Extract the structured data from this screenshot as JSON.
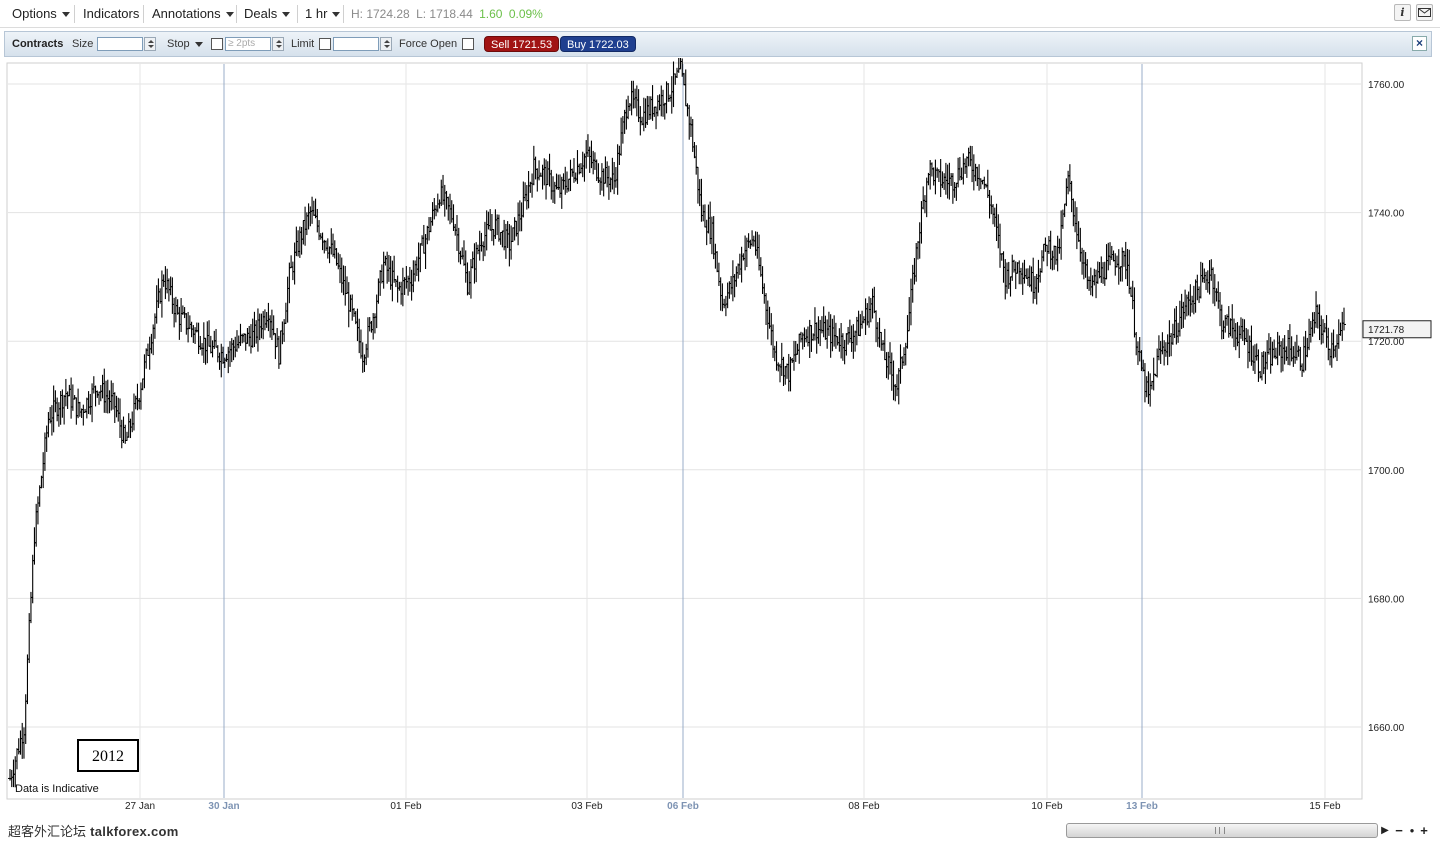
{
  "menubar": {
    "options_label": "Options",
    "indicators_label": "Indicators",
    "annotations_label": "Annotations",
    "deals_label": "Deals",
    "interval_label": "1 hr",
    "high": "H: 1724.28",
    "low": "L: 1718.44",
    "change": "1.60",
    "change_pct": "0.09%"
  },
  "dealbar": {
    "contracts_label": "Contracts",
    "size_label": "Size",
    "size_value": "",
    "stop_label": "Stop",
    "stop_placeholder": "≥ 2pts",
    "limit_label": "Limit",
    "limit_value": "",
    "force_open_label": "Force Open",
    "sell_label": "Sell 1721.53",
    "buy_label": "Buy 1722.03",
    "close_label": "×"
  },
  "chart_data": {
    "type": "ohlc",
    "interval": "1 hr",
    "y_ticks": [
      "1760.00",
      "1740.00",
      "1720.00",
      "1700.00",
      "1680.00",
      "1660.00"
    ],
    "ylim": [
      1648,
      1763
    ],
    "x_ticks": [
      {
        "label": "27 Jan",
        "weekstart": false
      },
      {
        "label": "30 Jan",
        "weekstart": true
      },
      {
        "label": "01 Feb",
        "weekstart": false
      },
      {
        "label": "03 Feb",
        "weekstart": false
      },
      {
        "label": "06 Feb",
        "weekstart": true
      },
      {
        "label": "08 Feb",
        "weekstart": false
      },
      {
        "label": "10 Feb",
        "weekstart": false
      },
      {
        "label": "13 Feb",
        "weekstart": true
      },
      {
        "label": "15 Feb",
        "weekstart": false
      }
    ],
    "current_price": "1721.78",
    "year_label": "2012",
    "note": "Data is Indicative",
    "trajectory": [
      [
        0,
        1652
      ],
      [
        8,
        1660
      ],
      [
        14,
        1690
      ],
      [
        22,
        1708
      ],
      [
        32,
        1712
      ],
      [
        40,
        1709
      ],
      [
        50,
        1713
      ],
      [
        60,
        1710
      ],
      [
        66,
        1704
      ],
      [
        74,
        1712
      ],
      [
        80,
        1720
      ],
      [
        88,
        1730
      ],
      [
        96,
        1724
      ],
      [
        104,
        1722
      ],
      [
        114,
        1719
      ],
      [
        122,
        1718
      ],
      [
        132,
        1720
      ],
      [
        140,
        1721
      ],
      [
        148,
        1725
      ],
      [
        154,
        1718
      ],
      [
        160,
        1730
      ],
      [
        166,
        1736
      ],
      [
        172,
        1740
      ],
      [
        178,
        1737
      ],
      [
        186,
        1733
      ],
      [
        194,
        1726
      ],
      [
        202,
        1718
      ],
      [
        208,
        1724
      ],
      [
        214,
        1732
      ],
      [
        222,
        1728
      ],
      [
        230,
        1730
      ],
      [
        238,
        1736
      ],
      [
        246,
        1743
      ],
      [
        254,
        1739
      ],
      [
        262,
        1729
      ],
      [
        270,
        1736
      ],
      [
        278,
        1738
      ],
      [
        286,
        1735
      ],
      [
        294,
        1741
      ],
      [
        300,
        1747
      ],
      [
        306,
        1746
      ],
      [
        314,
        1743
      ],
      [
        322,
        1746
      ],
      [
        330,
        1749
      ],
      [
        338,
        1746
      ],
      [
        346,
        1745
      ],
      [
        354,
        1758
      ],
      [
        362,
        1755
      ],
      [
        370,
        1757
      ],
      [
        378,
        1759
      ],
      [
        384,
        1762
      ],
      [
        390,
        1753
      ],
      [
        396,
        1740
      ],
      [
        402,
        1737
      ],
      [
        408,
        1726
      ],
      [
        414,
        1729
      ],
      [
        420,
        1734
      ],
      [
        426,
        1736
      ],
      [
        432,
        1727
      ],
      [
        438,
        1718
      ],
      [
        446,
        1715
      ],
      [
        454,
        1721
      ],
      [
        462,
        1722
      ],
      [
        470,
        1721
      ],
      [
        478,
        1720
      ],
      [
        486,
        1722
      ],
      [
        494,
        1726
      ],
      [
        500,
        1718
      ],
      [
        508,
        1713
      ],
      [
        514,
        1722
      ],
      [
        520,
        1736
      ],
      [
        526,
        1747
      ],
      [
        532,
        1745
      ],
      [
        540,
        1745
      ],
      [
        548,
        1748
      ],
      [
        556,
        1746
      ],
      [
        562,
        1741
      ],
      [
        570,
        1730
      ],
      [
        578,
        1732
      ],
      [
        586,
        1729
      ],
      [
        594,
        1735
      ],
      [
        600,
        1733
      ],
      [
        606,
        1745
      ],
      [
        612,
        1736
      ],
      [
        618,
        1728
      ],
      [
        626,
        1731
      ],
      [
        634,
        1733
      ],
      [
        640,
        1732
      ],
      [
        646,
        1718
      ],
      [
        652,
        1711
      ],
      [
        658,
        1718
      ],
      [
        666,
        1721
      ],
      [
        672,
        1725
      ],
      [
        680,
        1728
      ],
      [
        688,
        1731
      ],
      [
        694,
        1723
      ],
      [
        700,
        1722
      ],
      [
        708,
        1720
      ],
      [
        716,
        1716
      ],
      [
        724,
        1718
      ],
      [
        732,
        1719
      ],
      [
        740,
        1717
      ],
      [
        748,
        1724
      ],
      [
        756,
        1719
      ],
      [
        764,
        1722
      ]
    ]
  },
  "watermark": {
    "prefix": "超客外汇论坛 ",
    "site": "talkforex.com"
  },
  "scroll": {
    "right_arrow": "▶",
    "zoom_out": "−",
    "zoom_dot": "●",
    "zoom_in": "+"
  }
}
